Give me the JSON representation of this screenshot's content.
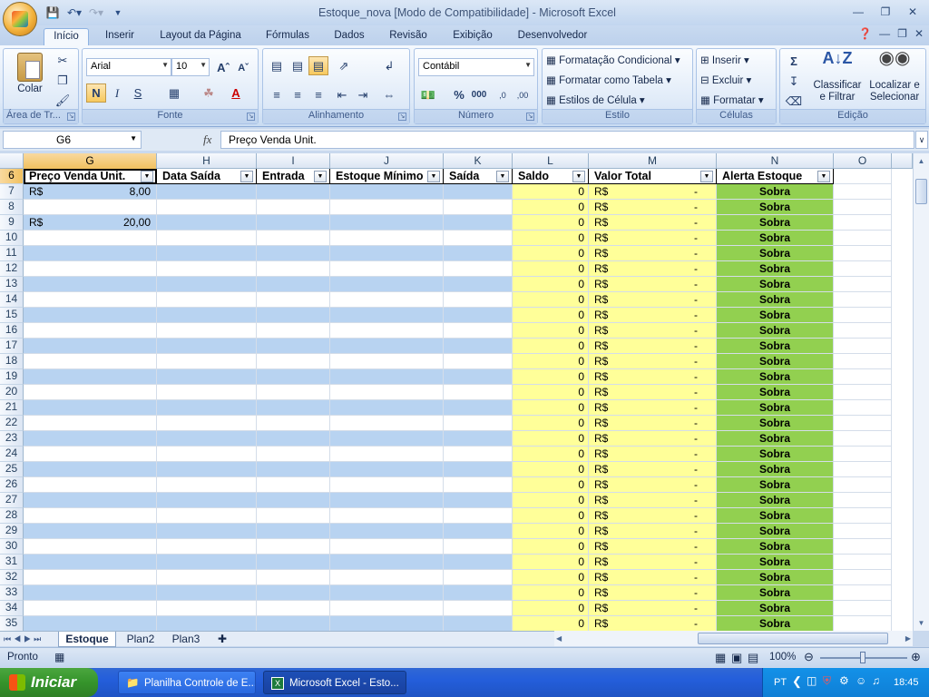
{
  "window": {
    "title": "Estoque_nova  [Modo de Compatibilidade] - Microsoft Excel"
  },
  "ribbon_tabs": [
    "Início",
    "Inserir",
    "Layout da Página",
    "Fórmulas",
    "Dados",
    "Revisão",
    "Exibição",
    "Desenvolvedor"
  ],
  "ribbon": {
    "clipboard": {
      "label": "Área de Tr...",
      "paste": "Colar"
    },
    "font": {
      "label": "Fonte",
      "font_name": "Arial",
      "font_size": "10",
      "bold": "N",
      "italic": "I",
      "underline": "S"
    },
    "alignment": {
      "label": "Alinhamento"
    },
    "number": {
      "label": "Número",
      "format": "Contábil"
    },
    "styles": {
      "label": "Estilo",
      "conditional": "Formatação Condicional",
      "as_table": "Formatar como Tabela",
      "cell_styles": "Estilos de Célula"
    },
    "cells": {
      "label": "Células",
      "insert": "Inserir",
      "delete": "Excluir",
      "format": "Formatar"
    },
    "editing": {
      "label": "Edição",
      "sort_line1": "Classificar",
      "sort_line2": "e Filtrar",
      "find_line1": "Localizar e",
      "find_line2": "Selecionar"
    }
  },
  "formula_bar": {
    "name_box": "G6",
    "fx": "fx",
    "formula": "Preço Venda Unit."
  },
  "columns": [
    "G",
    "H",
    "I",
    "J",
    "K",
    "L",
    "M",
    "N",
    "O"
  ],
  "table_headers": [
    "Preço Venda Unit.",
    "Data Saída",
    "Entrada",
    "Estoque Mínimo",
    "Saída",
    "Saldo",
    "Valor Total",
    "Alerta Estoque"
  ],
  "header_row": "6",
  "rows": [
    {
      "n": "7",
      "g_cur": "R$",
      "g_val": "8,00",
      "saldo": "0",
      "vt_cur": "R$",
      "vt_val": "-",
      "alerta": "Sobra"
    },
    {
      "n": "8",
      "g_cur": "",
      "g_val": "",
      "saldo": "0",
      "vt_cur": "R$",
      "vt_val": "-",
      "alerta": "Sobra"
    },
    {
      "n": "9",
      "g_cur": "R$",
      "g_val": "20,00",
      "saldo": "0",
      "vt_cur": "R$",
      "vt_val": "-",
      "alerta": "Sobra"
    },
    {
      "n": "10",
      "g_cur": "",
      "g_val": "",
      "saldo": "0",
      "vt_cur": "R$",
      "vt_val": "-",
      "alerta": "Sobra"
    },
    {
      "n": "11",
      "g_cur": "",
      "g_val": "",
      "saldo": "0",
      "vt_cur": "R$",
      "vt_val": "-",
      "alerta": "Sobra"
    },
    {
      "n": "12",
      "g_cur": "",
      "g_val": "",
      "saldo": "0",
      "vt_cur": "R$",
      "vt_val": "-",
      "alerta": "Sobra"
    },
    {
      "n": "13",
      "g_cur": "",
      "g_val": "",
      "saldo": "0",
      "vt_cur": "R$",
      "vt_val": "-",
      "alerta": "Sobra"
    },
    {
      "n": "14",
      "g_cur": "",
      "g_val": "",
      "saldo": "0",
      "vt_cur": "R$",
      "vt_val": "-",
      "alerta": "Sobra"
    },
    {
      "n": "15",
      "g_cur": "",
      "g_val": "",
      "saldo": "0",
      "vt_cur": "R$",
      "vt_val": "-",
      "alerta": "Sobra"
    },
    {
      "n": "16",
      "g_cur": "",
      "g_val": "",
      "saldo": "0",
      "vt_cur": "R$",
      "vt_val": "-",
      "alerta": "Sobra"
    },
    {
      "n": "17",
      "g_cur": "",
      "g_val": "",
      "saldo": "0",
      "vt_cur": "R$",
      "vt_val": "-",
      "alerta": "Sobra"
    },
    {
      "n": "18",
      "g_cur": "",
      "g_val": "",
      "saldo": "0",
      "vt_cur": "R$",
      "vt_val": "-",
      "alerta": "Sobra"
    },
    {
      "n": "19",
      "g_cur": "",
      "g_val": "",
      "saldo": "0",
      "vt_cur": "R$",
      "vt_val": "-",
      "alerta": "Sobra"
    },
    {
      "n": "20",
      "g_cur": "",
      "g_val": "",
      "saldo": "0",
      "vt_cur": "R$",
      "vt_val": "-",
      "alerta": "Sobra"
    },
    {
      "n": "21",
      "g_cur": "",
      "g_val": "",
      "saldo": "0",
      "vt_cur": "R$",
      "vt_val": "-",
      "alerta": "Sobra"
    },
    {
      "n": "22",
      "g_cur": "",
      "g_val": "",
      "saldo": "0",
      "vt_cur": "R$",
      "vt_val": "-",
      "alerta": "Sobra"
    },
    {
      "n": "23",
      "g_cur": "",
      "g_val": "",
      "saldo": "0",
      "vt_cur": "R$",
      "vt_val": "-",
      "alerta": "Sobra"
    },
    {
      "n": "24",
      "g_cur": "",
      "g_val": "",
      "saldo": "0",
      "vt_cur": "R$",
      "vt_val": "-",
      "alerta": "Sobra"
    },
    {
      "n": "25",
      "g_cur": "",
      "g_val": "",
      "saldo": "0",
      "vt_cur": "R$",
      "vt_val": "-",
      "alerta": "Sobra"
    },
    {
      "n": "26",
      "g_cur": "",
      "g_val": "",
      "saldo": "0",
      "vt_cur": "R$",
      "vt_val": "-",
      "alerta": "Sobra"
    },
    {
      "n": "27",
      "g_cur": "",
      "g_val": "",
      "saldo": "0",
      "vt_cur": "R$",
      "vt_val": "-",
      "alerta": "Sobra"
    },
    {
      "n": "28",
      "g_cur": "",
      "g_val": "",
      "saldo": "0",
      "vt_cur": "R$",
      "vt_val": "-",
      "alerta": "Sobra"
    },
    {
      "n": "29",
      "g_cur": "",
      "g_val": "",
      "saldo": "0",
      "vt_cur": "R$",
      "vt_val": "-",
      "alerta": "Sobra"
    },
    {
      "n": "30",
      "g_cur": "",
      "g_val": "",
      "saldo": "0",
      "vt_cur": "R$",
      "vt_val": "-",
      "alerta": "Sobra"
    },
    {
      "n": "31",
      "g_cur": "",
      "g_val": "",
      "saldo": "0",
      "vt_cur": "R$",
      "vt_val": "-",
      "alerta": "Sobra"
    },
    {
      "n": "32",
      "g_cur": "",
      "g_val": "",
      "saldo": "0",
      "vt_cur": "R$",
      "vt_val": "-",
      "alerta": "Sobra"
    },
    {
      "n": "33",
      "g_cur": "",
      "g_val": "",
      "saldo": "0",
      "vt_cur": "R$",
      "vt_val": "-",
      "alerta": "Sobra"
    },
    {
      "n": "34",
      "g_cur": "",
      "g_val": "",
      "saldo": "0",
      "vt_cur": "R$",
      "vt_val": "-",
      "alerta": "Sobra"
    },
    {
      "n": "35",
      "g_cur": "",
      "g_val": "",
      "saldo": "0",
      "vt_cur": "R$",
      "vt_val": "-",
      "alerta": "Sobra"
    }
  ],
  "sheet_tabs": [
    "Estoque",
    "Plan2",
    "Plan3"
  ],
  "status": {
    "ready": "Pronto",
    "zoom": "100%"
  },
  "taskbar": {
    "start": "Iniciar",
    "tasks": [
      "Planilha Controle de E...",
      "Microsoft Excel - Esto..."
    ],
    "lang": "PT",
    "clock": "18:45"
  },
  "colors": {
    "band_blue": "#b8d3f1",
    "saldo_yellow": "#ffff99",
    "alerta_green": "#92d050",
    "selected_header": "#f6c86a"
  }
}
